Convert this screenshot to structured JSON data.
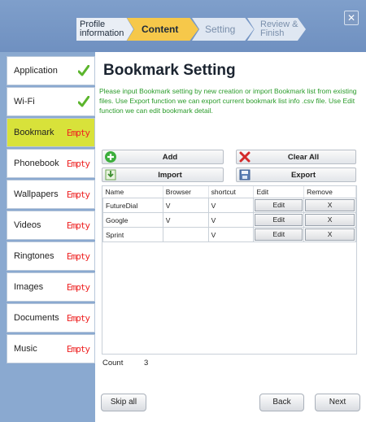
{
  "wizard": {
    "steps": [
      {
        "label": "Profile information"
      },
      {
        "label": "Content"
      },
      {
        "label": "Setting"
      },
      {
        "label": "Review & Finish"
      }
    ],
    "active_step": "Content",
    "close_label": "✕"
  },
  "sidebar": {
    "items": [
      {
        "label": "Application",
        "status": "check"
      },
      {
        "label": "Wi-Fi",
        "status": "check"
      },
      {
        "label": "Bookmark",
        "status": "Empty"
      },
      {
        "label": "Phonebook",
        "status": "Empty"
      },
      {
        "label": "Wallpapers",
        "status": "Empty"
      },
      {
        "label": "Videos",
        "status": "Empty"
      },
      {
        "label": "Ringtones",
        "status": "Empty"
      },
      {
        "label": "Images",
        "status": "Empty"
      },
      {
        "label": "Documents",
        "status": "Empty"
      },
      {
        "label": "Music",
        "status": "Empty"
      }
    ],
    "active_item": "Bookmark"
  },
  "main": {
    "title": "Bookmark Setting",
    "description": "Please input Bookmark setting by new creation or import Bookmark list from existing files. Use Export function we can export current bookmark list info .csv file. Use Edit function we can edit bookmark detail.",
    "toolbar": {
      "add_label": "Add",
      "import_label": "Import",
      "clear_all_label": "Clear All",
      "export_label": "Export"
    },
    "table": {
      "columns": [
        "Name",
        "Browser",
        "shortcut",
        "Edit",
        "Remove"
      ],
      "rows": [
        {
          "name": "FutureDial",
          "browser": "V",
          "shortcut": "V",
          "edit": "Edit",
          "remove": "X"
        },
        {
          "name": "Google",
          "browser": "V",
          "shortcut": "V",
          "edit": "Edit",
          "remove": "X"
        },
        {
          "name": "Sprint",
          "browser": "",
          "shortcut": "V",
          "edit": "Edit",
          "remove": "X"
        }
      ]
    },
    "count_label": "Count",
    "count_value": "3"
  },
  "footer": {
    "skip_all_label": "Skip all",
    "back_label": "Back",
    "next_label": "Next"
  },
  "colors": {
    "accent_active_step": "#f6c84a",
    "sidebar_active": "#d8e23a",
    "description_text": "#2a9b2a",
    "empty_status": "#ee2222",
    "background": "#8aa9d0"
  }
}
